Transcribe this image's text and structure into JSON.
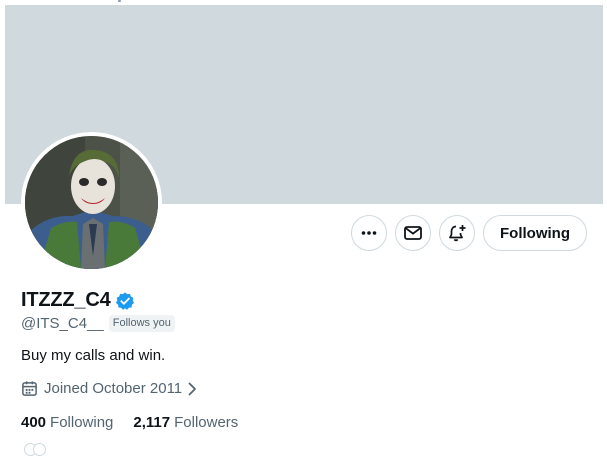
{
  "profile": {
    "display_name": "ITZZZ_C4",
    "handle": "@ITS_C4__",
    "follows_you": "Follows you",
    "bio": "Buy my calls and win.",
    "joined": "Joined October 2011",
    "verified": true
  },
  "stats": {
    "following_count": "400",
    "following_label": "Following",
    "followers_count": "2,117",
    "followers_label": "Followers"
  },
  "actions": {
    "more_icon": "more-icon",
    "message_icon": "mail-icon",
    "notify_icon": "bell-plus-icon",
    "following_label": "Following"
  },
  "colors": {
    "banner": "#cfd9de",
    "verified_badge": "#1d9bf0",
    "secondary_text": "#536471",
    "primary_text": "#0f1419"
  }
}
